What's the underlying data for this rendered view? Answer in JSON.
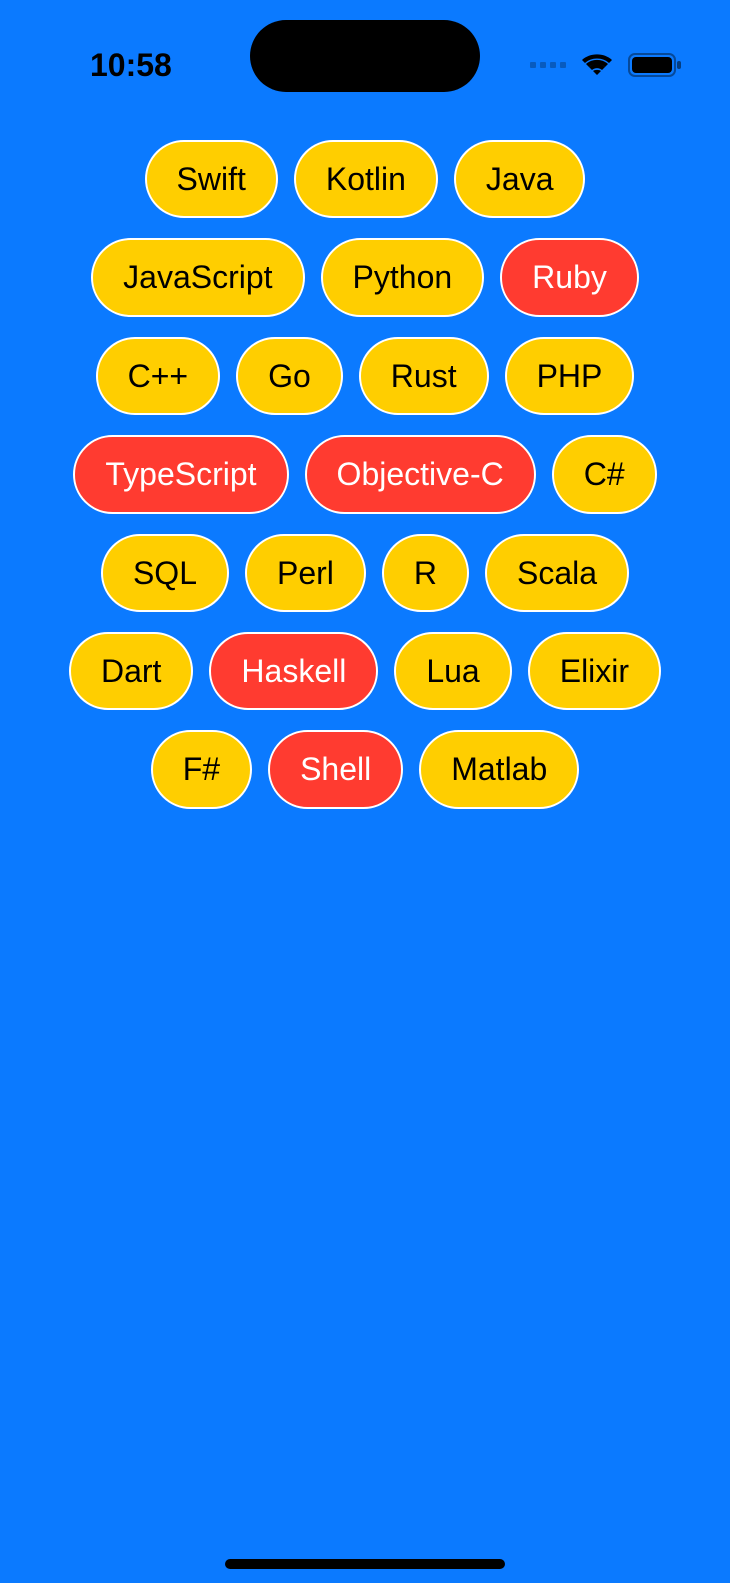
{
  "statusBar": {
    "time": "10:58"
  },
  "colors": {
    "background": "#0b7aff",
    "chipUnselected": "#ffce00",
    "chipSelected": "#ff3b30",
    "chipBorder": "#ffffff",
    "textDark": "#000000",
    "textLight": "#ffffff"
  },
  "chips": [
    {
      "label": "Swift",
      "selected": false
    },
    {
      "label": "Kotlin",
      "selected": false
    },
    {
      "label": "Java",
      "selected": false
    },
    {
      "label": "JavaScript",
      "selected": false
    },
    {
      "label": "Python",
      "selected": false
    },
    {
      "label": "Ruby",
      "selected": true
    },
    {
      "label": "C++",
      "selected": false
    },
    {
      "label": "Go",
      "selected": false
    },
    {
      "label": "Rust",
      "selected": false
    },
    {
      "label": "PHP",
      "selected": false
    },
    {
      "label": "TypeScript",
      "selected": true
    },
    {
      "label": "Objective-C",
      "selected": true
    },
    {
      "label": "C#",
      "selected": false
    },
    {
      "label": "SQL",
      "selected": false
    },
    {
      "label": "Perl",
      "selected": false
    },
    {
      "label": "R",
      "selected": false
    },
    {
      "label": "Scala",
      "selected": false
    },
    {
      "label": "Dart",
      "selected": false
    },
    {
      "label": "Haskell",
      "selected": true
    },
    {
      "label": "Lua",
      "selected": false
    },
    {
      "label": "Elixir",
      "selected": false
    },
    {
      "label": "F#",
      "selected": false
    },
    {
      "label": "Shell",
      "selected": true
    },
    {
      "label": "Matlab",
      "selected": false
    }
  ]
}
